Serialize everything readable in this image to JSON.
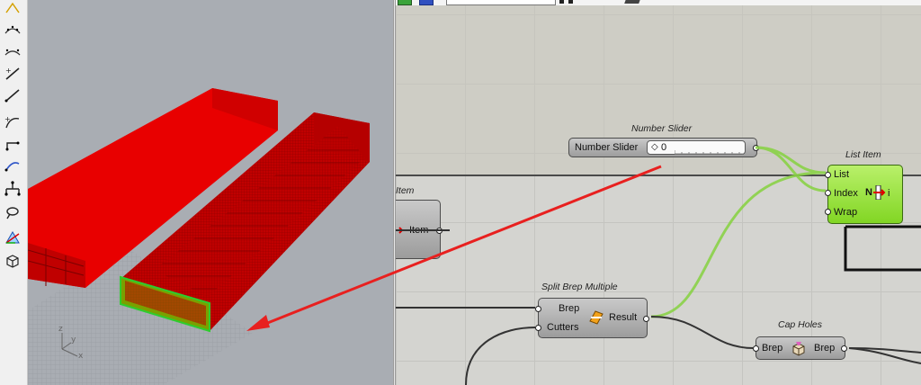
{
  "toolbar": {
    "tools": [
      "curve-point-icon",
      "curve-interp-icon",
      "line-icon",
      "polyline-icon",
      "tangent-icon",
      "fillet-icon",
      "arc-icon",
      "tree-icon",
      "lasso-icon",
      "axis-icon",
      "box-icon"
    ]
  },
  "viewport": {
    "axis_labels": {
      "x": "x",
      "y": "y",
      "z": "z"
    },
    "colors": {
      "solid": "#e80000",
      "mesh": "#b30000",
      "grid": "#8f9399",
      "highlight": "#2ecc2e"
    }
  },
  "canvas": {
    "number_slider": {
      "title": "Number Slider",
      "label": "Number Slider",
      "value_prefix": "◇",
      "value": "0"
    },
    "list_item": {
      "title": "List Item",
      "inputs": [
        "List",
        "Index",
        "Wrap"
      ],
      "icon_text": "N",
      "output": "i"
    },
    "item_partial": {
      "title": "Item",
      "output": "Item"
    },
    "split_brep": {
      "title": "Split Brep Multiple",
      "inputs": [
        "Brep",
        "Cutters"
      ],
      "output": "Result"
    },
    "cap_holes": {
      "title": "Cap Holes",
      "input": "Brep",
      "output": "Brep"
    },
    "colors": {
      "wire_active": "#8ad247",
      "wire": "#333333",
      "annotation": "#e8201f"
    }
  }
}
